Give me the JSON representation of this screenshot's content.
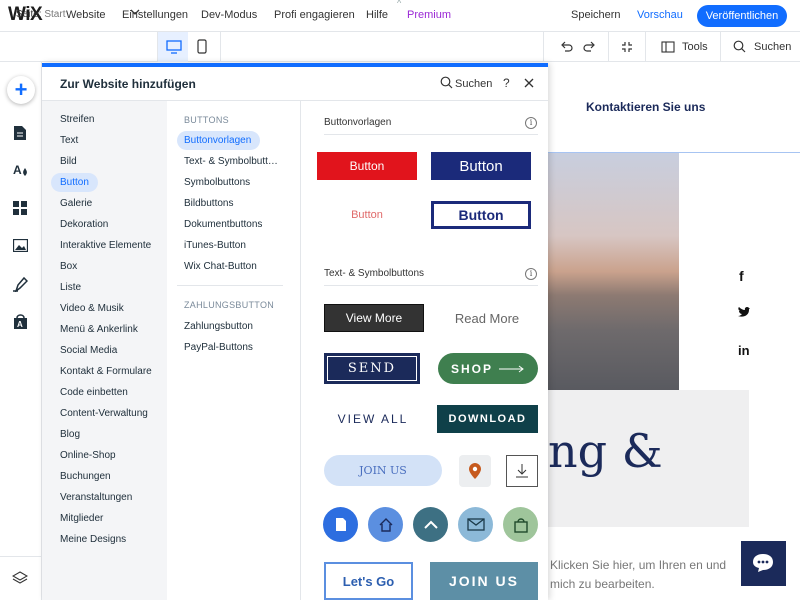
{
  "topbar": {
    "logo": "WiX",
    "nav": [
      "Website",
      "Einstellungen",
      "Dev-Modus",
      "Profi engagieren",
      "Hilfe",
      "Premium"
    ],
    "save": "Speichern",
    "preview": "Vorschau",
    "publish": "Veröffentlichen"
  },
  "secbar": {
    "page_prefix": "Seite:",
    "page_name": "Start",
    "tools": "Tools",
    "search": "Suchen"
  },
  "panel": {
    "title": "Zur Website hinzufügen",
    "search": "Suchen",
    "help": "?",
    "categories": [
      "Streifen",
      "Text",
      "Bild",
      "Button",
      "Galerie",
      "Dekoration",
      "Interaktive Elemente",
      "Box",
      "Liste",
      "Video & Musik",
      "Menü & Ankerlink",
      "Social Media",
      "Kontakt & Formulare",
      "Code einbetten",
      "Content-Verwaltung",
      "Blog",
      "Online-Shop",
      "Buchungen",
      "Veranstaltungen",
      "Mitglieder",
      "Meine Designs"
    ],
    "active_category": "Button",
    "sub_heading_1": "BUTTONS",
    "sub_items_1": [
      "Buttonvorlagen",
      "Text- & Symbolbutt…",
      "Symbolbuttons",
      "Bildbuttons",
      "Dokumentbuttons",
      "iTunes-Button",
      "Wix Chat-Button"
    ],
    "sub_heading_2": "ZAHLUNGSBUTTON",
    "sub_items_2": [
      "Zahlungsbutton",
      "PayPal-Buttons"
    ],
    "section1_title": "Buttonvorlagen",
    "section2_title": "Text- & Symbolbuttons",
    "buttons": {
      "b1": "Button",
      "b2": "Button",
      "b3": "Button",
      "b4": "Button",
      "view_more": "View More",
      "read_more": "Read More",
      "send": "SEND",
      "shop": "SHOP",
      "view_all": "VIEW ALL",
      "download": "DOWNLOAD",
      "join_us": "JOIN US",
      "lets_go": "Let's Go",
      "join_us_2": "JOIN US"
    }
  },
  "canvas": {
    "contact": "Kontaktieren Sie uns",
    "hero_title": "ng &",
    "hero_text": "Klicken Sie hier, um Ihren en und mich zu bearbeiten."
  },
  "colors": {
    "accent": "#116dff",
    "navy": "#1b2a5a",
    "red": "#e1141c",
    "green": "#3f7f4f",
    "teal": "#0f4049"
  }
}
